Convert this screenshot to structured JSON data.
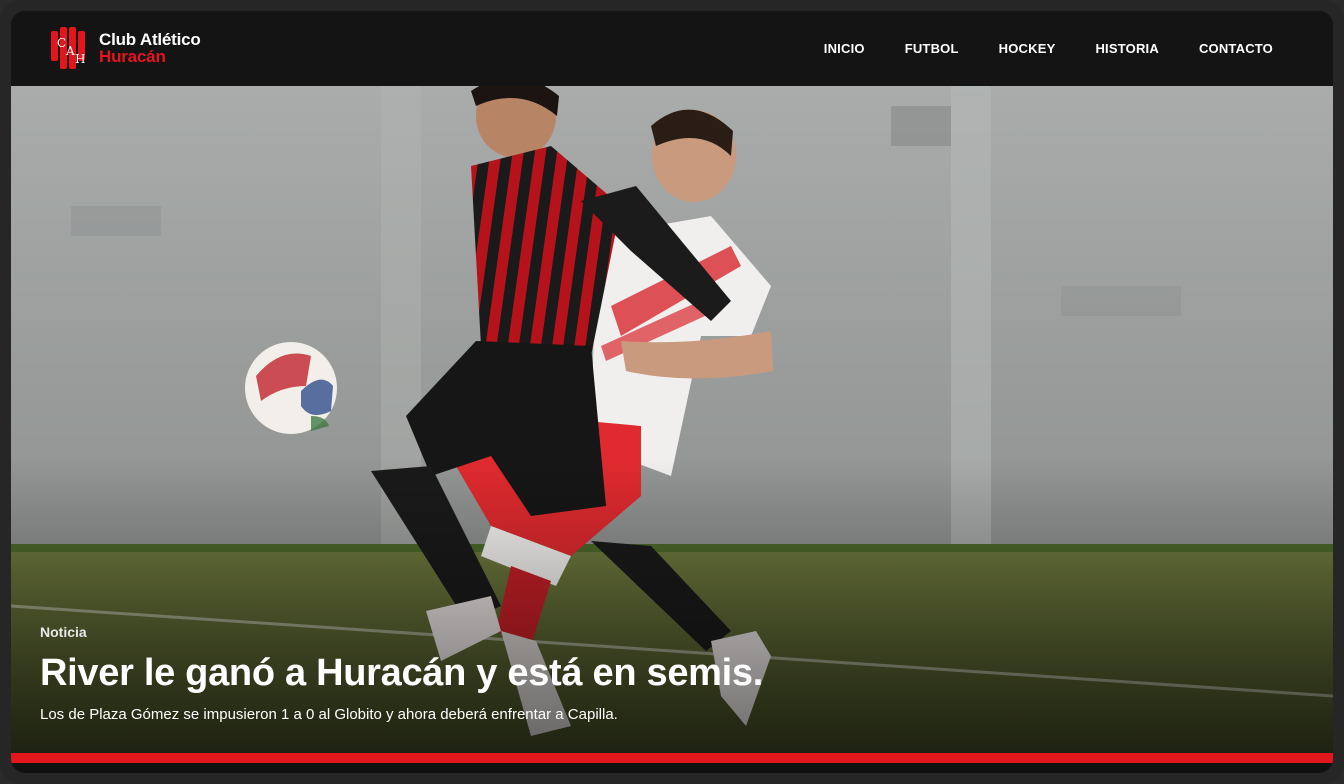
{
  "brand": {
    "initials": "CAH",
    "name_line1": "Club Atlético",
    "name_line2": "Huracán",
    "accent_color": "#e4161d",
    "logo_icon": "club-crest-icon"
  },
  "nav": {
    "items": [
      {
        "label": "INICIO"
      },
      {
        "label": "FUTBOL"
      },
      {
        "label": "HOCKEY"
      },
      {
        "label": "HISTORIA"
      },
      {
        "label": "CONTACTO"
      }
    ]
  },
  "hero": {
    "kicker": "Noticia",
    "headline": "River le ganó a Huracán y está en semis.",
    "summary": "Los de Plaza Gómez se impusieron 1 a 0 al Globito y ahora deberá enfrentar a Capilla."
  }
}
